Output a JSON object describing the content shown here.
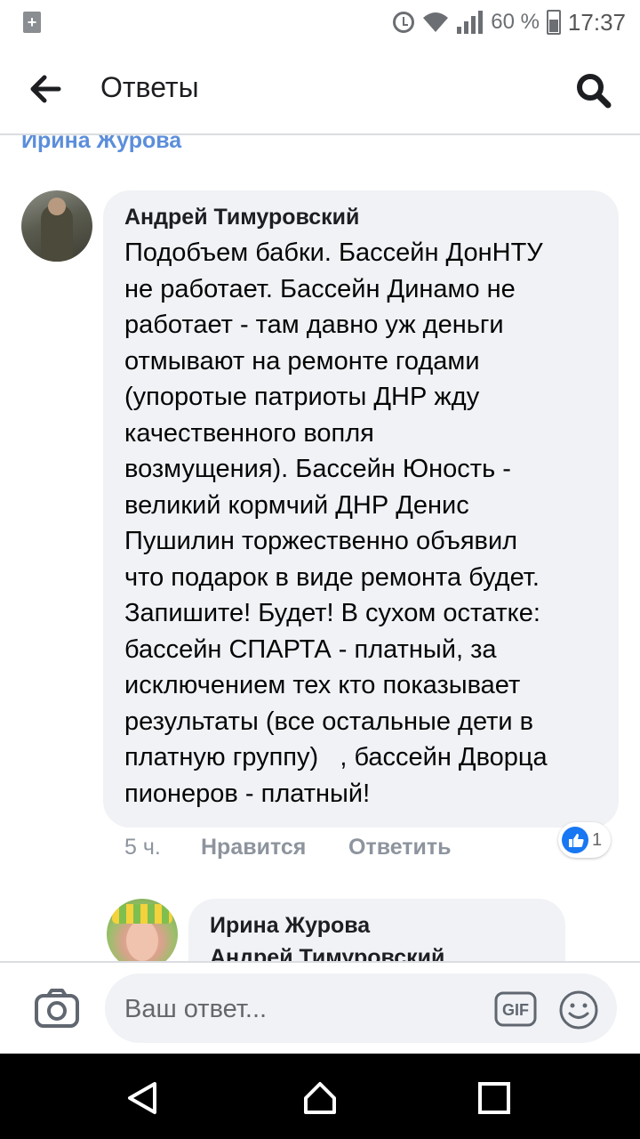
{
  "status_bar": {
    "battery": "60 %",
    "time": "17:37",
    "icons": [
      "notification-icon",
      "alarm-icon",
      "wifi-icon",
      "signal-icon",
      "battery-icon"
    ]
  },
  "header": {
    "title": "Ответы",
    "back_icon": "back-arrow-icon",
    "search_icon": "search-icon"
  },
  "thread": {
    "previous_author": "Ирина Журова",
    "comment": {
      "author": "Андрей Тимуровский",
      "text": "Подобъем бабки. Бассейн ДонНТУ\nне работает. Бассейн Динамо не\nработает - там давно уж деньги\nотмывают на ремонте годами\n(упоротые патриоты ДНР жду\nкачественного вопля\nвозмущения). Бассейн Юность -\nвеликий кормчий ДНР Денис\nПушилин торжественно объявил\nчто подарок в виде ремонта будет.\nЗапишите! Будет! В сухом остатке:\nбассейн СПАРТА - платный, за\nисключением тех кто показывает\nрезультаты (все остальные дети в\nплатную группу)   , бассейн Дворца\nпионеров - платный!",
      "time": "5 ч.",
      "like_label": "Нравится",
      "reply_label": "Ответить",
      "reaction_count": "1"
    },
    "reply": {
      "author": "Ирина Журова",
      "mention": "Андрей Тимуровский"
    }
  },
  "composer": {
    "placeholder": "Ваш ответ...",
    "gif_label": "GIF"
  },
  "colors": {
    "accent": "#1877f2",
    "link_name": "#5b8edb",
    "bubble": "#f0f2f5",
    "muted": "#8d949e"
  }
}
